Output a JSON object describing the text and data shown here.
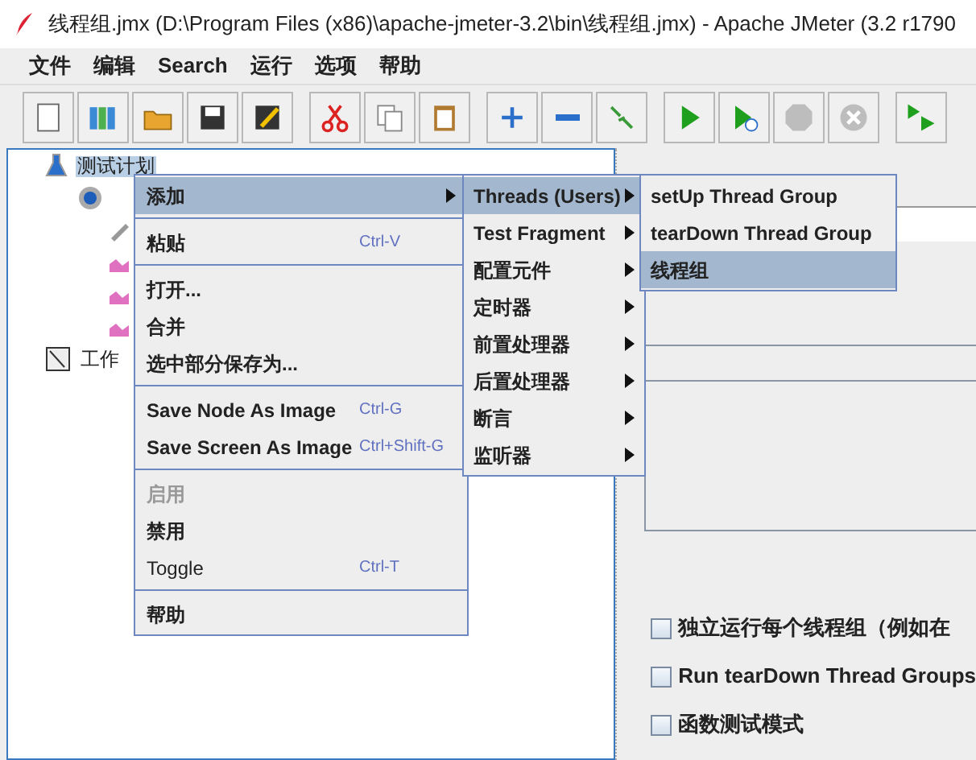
{
  "window": {
    "title": "线程组.jmx (D:\\Program Files (x86)\\apache-jmeter-3.2\\bin\\线程组.jmx) - Apache JMeter (3.2 r1790"
  },
  "menu_bar": [
    "文件",
    "编辑",
    "Search",
    "运行",
    "选项",
    "帮助"
  ],
  "toolbar": [
    {
      "kind": "new",
      "disabled": false
    },
    {
      "kind": "templates",
      "disabled": false
    },
    {
      "kind": "open",
      "disabled": false
    },
    {
      "kind": "save",
      "disabled": false
    },
    {
      "kind": "save-as",
      "disabled": false
    },
    {
      "kind": "gap"
    },
    {
      "kind": "cut",
      "disabled": false
    },
    {
      "kind": "copy",
      "disabled": false
    },
    {
      "kind": "paste",
      "disabled": false
    },
    {
      "kind": "gap"
    },
    {
      "kind": "expand",
      "disabled": false
    },
    {
      "kind": "collapse",
      "disabled": false
    },
    {
      "kind": "toggle",
      "disabled": false
    },
    {
      "kind": "gap"
    },
    {
      "kind": "start",
      "disabled": false
    },
    {
      "kind": "start-no-timers",
      "disabled": false
    },
    {
      "kind": "stop",
      "disabled": true
    },
    {
      "kind": "shutdown",
      "disabled": true
    },
    {
      "kind": "gap"
    },
    {
      "kind": "remote-start",
      "disabled": false
    }
  ],
  "tree": [
    {
      "kind": "plan",
      "label": "测试计划",
      "selected": true,
      "children": [
        {
          "kind": "thread-group",
          "children": [
            {
              "kind": "sampler"
            },
            {
              "kind": "listener"
            },
            {
              "kind": "listener"
            },
            {
              "kind": "listener"
            }
          ]
        }
      ]
    },
    {
      "kind": "workbench",
      "label": "工作",
      "selected": false
    }
  ],
  "context_menu": [
    {
      "kind": "item",
      "label": "添加",
      "submenu": true,
      "selected": true,
      "disabled": false,
      "bold": true
    },
    {
      "kind": "separator"
    },
    {
      "kind": "item",
      "label": "粘贴",
      "shortcut": "Ctrl-V",
      "submenu": false,
      "selected": false,
      "disabled": false,
      "bold": true
    },
    {
      "kind": "separator"
    },
    {
      "kind": "item",
      "label": "打开...",
      "submenu": false,
      "selected": false,
      "disabled": false,
      "bold": true
    },
    {
      "kind": "item",
      "label": "合并",
      "submenu": false,
      "selected": false,
      "disabled": false,
      "bold": true
    },
    {
      "kind": "item",
      "label": "选中部分保存为...",
      "submenu": false,
      "selected": false,
      "disabled": false,
      "bold": true
    },
    {
      "kind": "separator"
    },
    {
      "kind": "item",
      "label": "Save Node As Image",
      "shortcut": "Ctrl-G",
      "submenu": false,
      "selected": false,
      "disabled": false,
      "bold": true
    },
    {
      "kind": "item",
      "label": "Save Screen As Image",
      "shortcut": "Ctrl+Shift-G",
      "submenu": false,
      "selected": false,
      "disabled": false,
      "bold": true
    },
    {
      "kind": "separator"
    },
    {
      "kind": "item",
      "label": "启用",
      "submenu": false,
      "selected": false,
      "disabled": true,
      "bold": true
    },
    {
      "kind": "item",
      "label": "禁用",
      "submenu": false,
      "selected": false,
      "disabled": false,
      "bold": true
    },
    {
      "kind": "item",
      "label": "Toggle",
      "shortcut": "Ctrl-T",
      "submenu": false,
      "selected": false,
      "disabled": false,
      "bold": false
    },
    {
      "kind": "separator"
    },
    {
      "kind": "item",
      "label": "帮助",
      "submenu": false,
      "selected": false,
      "disabled": false,
      "bold": true
    }
  ],
  "add_submenu": [
    {
      "label": "Threads (Users)",
      "submenu": true,
      "selected": true
    },
    {
      "label": "Test Fragment",
      "submenu": true,
      "selected": false
    },
    {
      "label": "配置元件",
      "submenu": true,
      "selected": false
    },
    {
      "label": "定时器",
      "submenu": true,
      "selected": false
    },
    {
      "label": "前置处理器",
      "submenu": true,
      "selected": false
    },
    {
      "label": "后置处理器",
      "submenu": true,
      "selected": false
    },
    {
      "label": "断言",
      "submenu": true,
      "selected": false
    },
    {
      "label": "监听器",
      "submenu": true,
      "selected": false
    }
  ],
  "threads_submenu": [
    {
      "label": "setUp Thread Group",
      "selected": false
    },
    {
      "label": "tearDown Thread Group",
      "selected": false
    },
    {
      "label": "线程组",
      "selected": true
    }
  ],
  "options": [
    {
      "label": "独立运行每个线程组（例如在",
      "checked": false
    },
    {
      "label": "Run tearDown Thread Groups",
      "checked": false
    },
    {
      "label": "函数测试模式",
      "checked": false
    }
  ]
}
